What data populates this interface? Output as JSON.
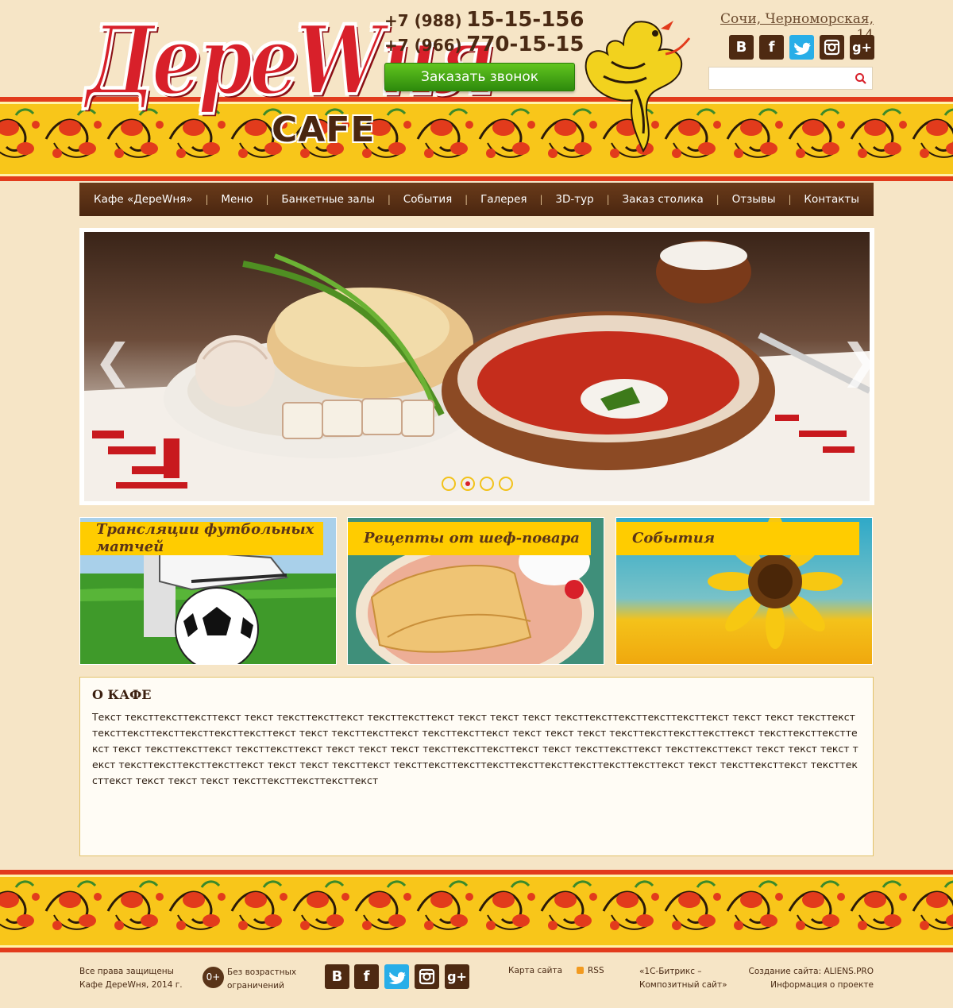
{
  "header": {
    "logo_text": "ДереWня",
    "logo_sub": "CAFE",
    "phones": [
      {
        "prefix": "+7 (988)",
        "number": "15-15-156"
      },
      {
        "prefix": "+7 (966)",
        "number": "770-15-15"
      }
    ],
    "call_button": "Заказать звонок",
    "address": "Сочи, Черноморская, 14",
    "social": [
      "В",
      "f",
      "t",
      "ig",
      "g+"
    ],
    "search_placeholder": ""
  },
  "nav": {
    "items": [
      "Кафе «ДереWня»",
      "Меню",
      "Банкетные залы",
      "События",
      "Галерея",
      "3D-тур",
      "Заказ столика",
      "Отзывы",
      "Контакты"
    ]
  },
  "slider": {
    "dots": 4,
    "active_dot": 1,
    "prev": "❮",
    "next": "❯"
  },
  "cards": [
    {
      "title": "Трансляции футбольных матчей",
      "image": "football-photo"
    },
    {
      "title": "Рецепты от шеф-повара",
      "image": "pancakes-photo"
    },
    {
      "title": "События",
      "image": "sunflower-photo"
    }
  ],
  "about": {
    "title": "О КАФЕ",
    "text": "Текст тексттексттексттекст текст тексттексттекст  тексттексттекст текст текст текст тексттексттексттексттексттекст текст текст тексттексттексттексттексттексттексттексттекст текст тексттексттекст  тексттексттекст текст текст текст тексттексттексттексттекст тексттексттексттекст текст тексттексттекст  тексттексттекст текст текст текст тексттексттексттекст текст тексттексттекст  тексттексттекст текст текст текст текст тексттексттексттексттекст текст текст тексттекст тексттексттексттексттексттексттексттексттексттекст текст тексттексттекст  тексттексттекст текст текст текст тексттексттексттексттекст"
  },
  "footer": {
    "copyright_1": "Все права защищены",
    "copyright_2": "Кафе ДереWня, 2014 г.",
    "age_badge": "0+",
    "age_text_1": "Без возрастных",
    "age_text_2": "ограничений",
    "sitemap": "Карта сайта",
    "rss": "RSS",
    "bitrix_1": "«1С-Битрикс –",
    "bitrix_2": "Композитный сайт»",
    "creator": "Создание сайта: ALIENS.PRO",
    "info": "Информация о проекте"
  },
  "colors": {
    "background": "#f6e5c6",
    "nav": "#5a3016",
    "accent_yellow": "#ffcc00",
    "accent_red": "#d8202a",
    "call_green": "#3fa313"
  }
}
